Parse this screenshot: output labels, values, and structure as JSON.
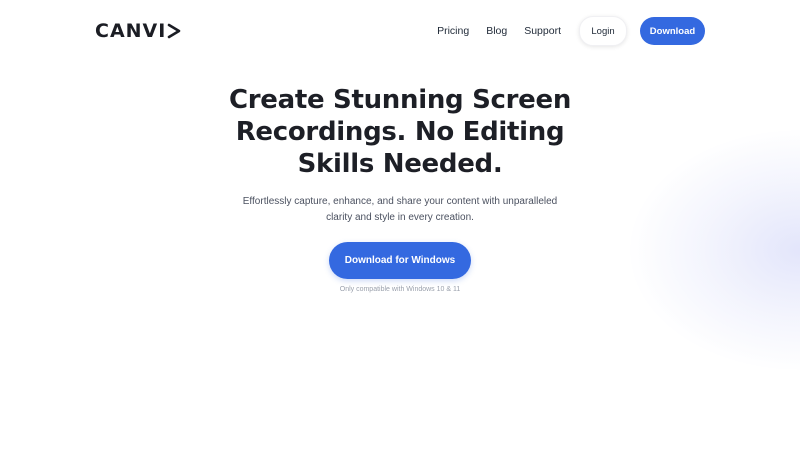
{
  "brand": {
    "logo_text": "CANVI",
    "logo_icon": "play-triangle-icon"
  },
  "nav": {
    "links": [
      {
        "label": "Pricing"
      },
      {
        "label": "Blog"
      },
      {
        "label": "Support"
      }
    ],
    "login_label": "Login",
    "download_label": "Download"
  },
  "hero": {
    "headline": "Create Stunning Screen Recordings. No Editing Skills Needed.",
    "subtitle": "Effortlessly capture, enhance, and share your content with unparalleled clarity and style in every creation.",
    "cta_label": "Download for Windows",
    "compat_note": "Only compatible with Windows 10 & 11"
  },
  "colors": {
    "accent": "#3469e0",
    "text": "#1d1f26",
    "muted": "#9aa0ac"
  }
}
